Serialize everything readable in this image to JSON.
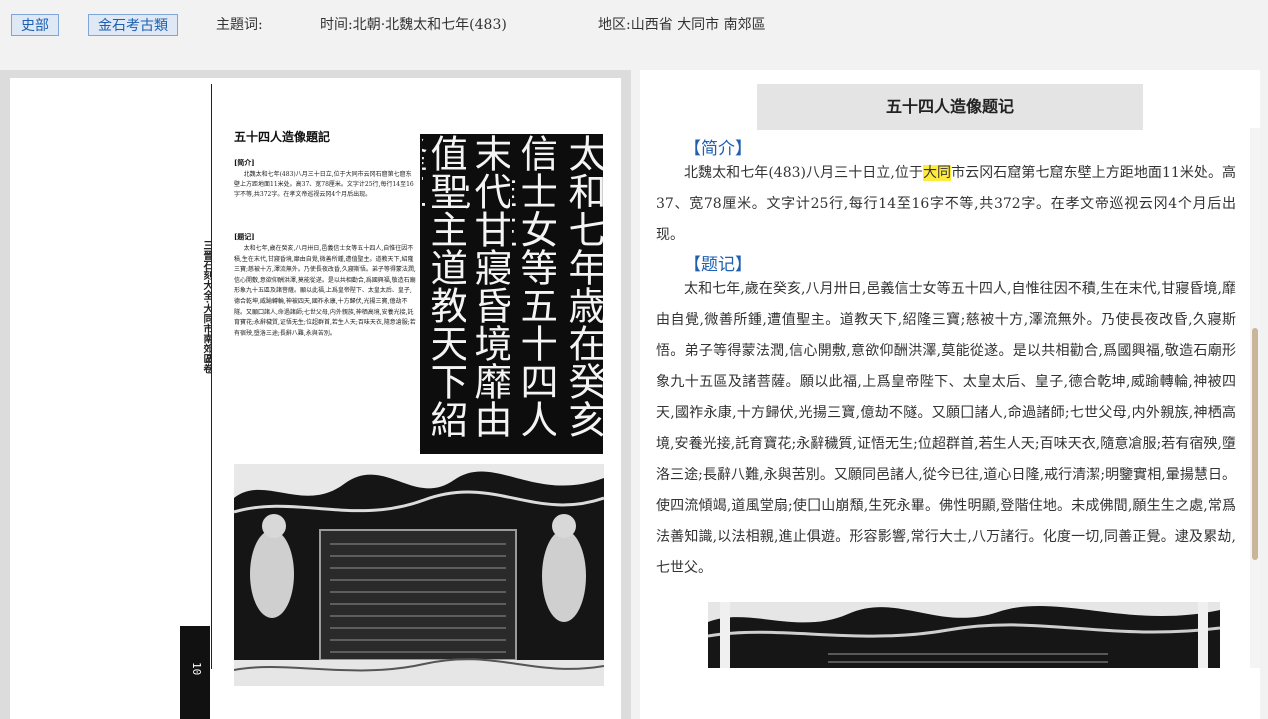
{
  "meta": {
    "tag_history": "史部",
    "tag_category": "金石考古類",
    "subject_label": "主題词:",
    "time_label": "时间:北朝·北魏太和七年(483)",
    "region_label": "地区:山西省 大同市 南郊區"
  },
  "scan": {
    "heading": "五十四人造像題記",
    "intro_tag": "[简介]",
    "intro_text": "北魏太和七年(483)八月三十日立,位于大同市云冈石窟第七窟东壁上方距地面11米处。高37、宽78厘米。文字计25行,每行14至16字不等,共372字。在孝文帝巡视云冈4个月后出现。",
    "record_tag": "[题记]",
    "record_text": "太和七年,歲在癸亥,八月卅日,邑義信士女等五十四人,自惟往因不積,生在末代,甘寢昏境,靡由自覺,微善所鍾,遭值聖主。道教天下,紹隆三寶;慈被十方,澤流無外。乃使長夜改昏,久寢斯悟。弟子等得蒙法潤,信心開敷,意欲仰酬洪澤,莫能從遂。是以共相勸合,爲國興福,敬造石廟形象九十五區及諸菩薩。願以此福,上爲皇帝陛下、太皇太后、皇子,德合乾坤,威踰轉輪,神被四天,國祚永康,十方歸伏,光揚三寶,億劫不隧。又願囗諸人,命過諸師;七世父母,内外親族,神栖高境,安養光接,託育寶花;永辭穢質,证悟无生;位超群首,若生人天;百味天衣,隨意凔服;若有宿殃,墮洛三途;長辭八難,永與苦別。",
    "spine_text": "三晉石刻大全·大同市南郊區卷",
    "page_number": "10",
    "calligraphy_cols": [
      "太和七年歳在癸亥",
      "信士女等五十四人自惟往",
      "末代甘寢昏境靡由自覺",
      "值聖主道教天下紹隆三"
    ]
  },
  "article": {
    "title": "五十四人造像题记",
    "intro_heading": "【简介】",
    "intro_before": "北魏太和七年(483)八月三十日立,位于",
    "intro_highlight": "大同",
    "intro_after": "市云冈石窟第七窟东壁上方距地面11米处。高37、宽78厘米。文字计25行,每行14至16字不等,共372字。在孝文帝巡视云冈4个月后出现。",
    "record_heading": "【题记】",
    "record_text": "太和七年,歲在癸亥,八月卅日,邑義信士女等五十四人,自惟往因不積,生在末代,甘寢昏境,靡由自覺,微善所鍾,遭值聖主。道教天下,紹隆三寶;慈被十方,澤流無外。乃使長夜改昏,久寢斯悟。弟子等得蒙法潤,信心開敷,意欲仰酬洪澤,莫能從遂。是以共相勸合,爲國興福,敬造石廟形象九十五區及諸菩薩。願以此福,上爲皇帝陛下、太皇太后、皇子,德合乾坤,威踰轉輪,神被四天,國祚永康,十方歸伏,光揚三寶,億劫不隧。又願囗諸人,命過諸師;七世父母,内外親族,神栖高境,安養光接,託育寶花;永辭穢質,证悟无生;位超群首,若生人天;百味天衣,隨意凔服;若有宿殃,墮洛三途;長辭八難,永與苦別。又願同邑諸人,從今已往,道心日隆,戒行清潔;明鑒實相,暈揚慧日。使四流傾竭,道風堂扇;使囗山崩頽,生死永畢。佛性明顯,登階住地。未成佛間,願生生之處,常爲法善知識,以法相親,進止俱遊。形容影響,常行大士,八万諸行。化度一切,同善正覺。逮及累劫,七世父。"
  }
}
